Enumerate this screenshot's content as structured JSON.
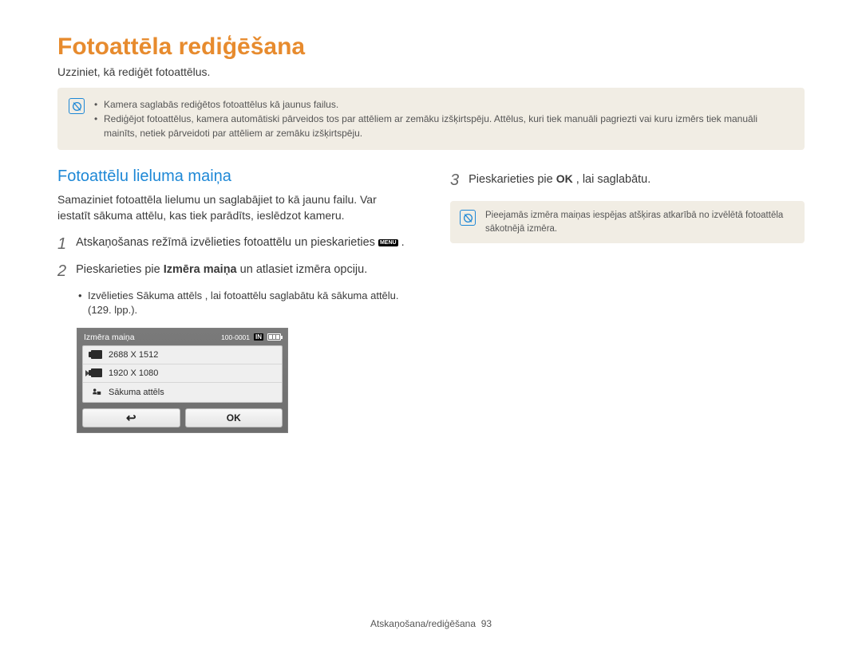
{
  "title": "Fotoattēla rediģēšana",
  "subtitle": "Uzziniet, kā rediģēt fotoattēlus.",
  "topNote": {
    "items": [
      "Kamera saglabās rediģētos fotoattēlus kā jaunus failus.",
      "Rediģējot fotoattēlus, kamera automātiski pārveidos tos par attēliem ar zemāku izšķirtspēju. Attēlus, kuri tiek manuāli pagriezti vai kuru izmērs tiek manuāli mainīts, netiek pārveidoti par attēliem ar zemāku izšķirtspēju."
    ]
  },
  "left": {
    "heading": "Fotoattēlu lieluma maiņa",
    "intro": "Samaziniet fotoattēla lielumu un saglabājiet to kā jaunu failu. Var iestatīt sākuma attēlu, kas tiek parādīts, ieslēdzot kameru.",
    "step1_pre": "Atskaņošanas režīmā izvēlieties fotoattēlu un pieskarieties ",
    "step1_menu": "MENU",
    "step1_post": " .",
    "step2_pre": "Pieskarieties pie ",
    "step2_bold": "Izmēra maiņa",
    "step2_post": " un atlasiet izmēra opciju.",
    "step2_sub_pre": "Izvēlieties ",
    "step2_sub_bold": "Sākuma attēls",
    "step2_sub_post": ", lai fotoattēlu saglabātu kā sākuma attēlu. (129. lpp.).",
    "num1": "1",
    "num2": "2"
  },
  "cam": {
    "title": "Izmēra maiņa",
    "counter": "100-0001",
    "mem": "IN",
    "opt1": "2688 X 1512",
    "opt2": "1920 X 1080",
    "opt3": "Sākuma attēls",
    "ok": "OK"
  },
  "right": {
    "num3": "3",
    "step3_pre": "Pieskarieties pie ",
    "step3_ok": "OK",
    "step3_post": ", lai saglabātu.",
    "note": "Pieejamās izmēra maiņas iespējas atšķiras atkarībā no izvēlētā fotoattēla sākotnējā izmēra."
  },
  "footer": {
    "section": "Atskaņošana/rediģēšana",
    "page": "93"
  }
}
